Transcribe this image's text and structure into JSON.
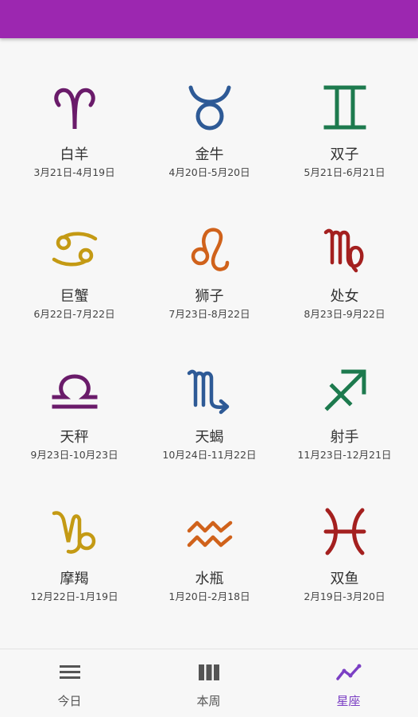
{
  "colors": {
    "app_bar": "#9c27b0",
    "purple": "#6a1b6a",
    "blue": "#2e5a96",
    "green": "#1d7a4e",
    "gold": "#c49a14",
    "orange": "#d0621b",
    "red": "#a4201f",
    "nav_active": "#7b3fc4",
    "nav_inactive": "#555555"
  },
  "signs": [
    {
      "name": "白羊",
      "range": "3月21日-4月19日",
      "icon": "aries-icon"
    },
    {
      "name": "金牛",
      "range": "4月20日-5月20日",
      "icon": "taurus-icon"
    },
    {
      "name": "双子",
      "range": "5月21日-6月21日",
      "icon": "gemini-icon"
    },
    {
      "name": "巨蟹",
      "range": "6月22日-7月22日",
      "icon": "cancer-icon"
    },
    {
      "name": "狮子",
      "range": "7月23日-8月22日",
      "icon": "leo-icon"
    },
    {
      "name": "处女",
      "range": "8月23日-9月22日",
      "icon": "virgo-icon"
    },
    {
      "name": "天秤",
      "range": "9月23日-10月23日",
      "icon": "libra-icon"
    },
    {
      "name": "天蝎",
      "range": "10月24日-11月22日",
      "icon": "scorpio-icon"
    },
    {
      "name": "射手",
      "range": "11月23日-12月21日",
      "icon": "sagittarius-icon"
    },
    {
      "name": "摩羯",
      "range": "12月22日-1月19日",
      "icon": "capricorn-icon"
    },
    {
      "name": "水瓶",
      "range": "1月20日-2月18日",
      "icon": "aquarius-icon"
    },
    {
      "name": "双鱼",
      "range": "2月19日-3月20日",
      "icon": "pisces-icon"
    }
  ],
  "bottom_nav": {
    "items": [
      {
        "label": "今日",
        "icon": "list-icon",
        "active": false
      },
      {
        "label": "本周",
        "icon": "columns-icon",
        "active": false
      },
      {
        "label": "星座",
        "icon": "trend-icon",
        "active": true
      }
    ]
  }
}
